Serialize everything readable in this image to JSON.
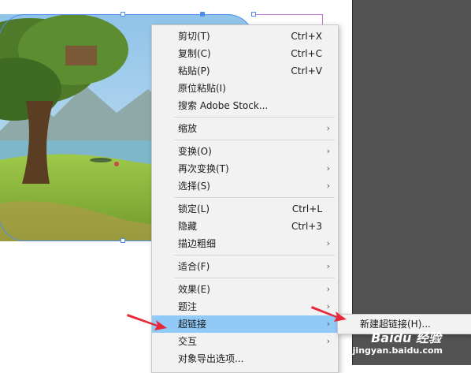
{
  "menu": {
    "items": [
      {
        "label": "剪切(T)",
        "shortcut": "Ctrl+X",
        "submenu": false
      },
      {
        "label": "复制(C)",
        "shortcut": "Ctrl+C",
        "submenu": false
      },
      {
        "label": "粘贴(P)",
        "shortcut": "Ctrl+V",
        "submenu": false
      },
      {
        "label": "原位粘贴(I)",
        "shortcut": "",
        "submenu": false
      },
      {
        "label": "搜索 Adobe Stock...",
        "shortcut": "",
        "submenu": false
      },
      {
        "label": "缩放",
        "shortcut": "",
        "submenu": true
      },
      {
        "label": "变换(O)",
        "shortcut": "",
        "submenu": true
      },
      {
        "label": "再次变换(T)",
        "shortcut": "",
        "submenu": true
      },
      {
        "label": "选择(S)",
        "shortcut": "",
        "submenu": true
      },
      {
        "label": "锁定(L)",
        "shortcut": "Ctrl+L",
        "submenu": false
      },
      {
        "label": "隐藏",
        "shortcut": "Ctrl+3",
        "submenu": false
      },
      {
        "label": "描边粗细",
        "shortcut": "",
        "submenu": true
      },
      {
        "label": "适合(F)",
        "shortcut": "",
        "submenu": true
      },
      {
        "label": "效果(E)",
        "shortcut": "",
        "submenu": true
      },
      {
        "label": "题注",
        "shortcut": "",
        "submenu": true
      },
      {
        "label": "超链接",
        "shortcut": "",
        "submenu": true,
        "highlighted": true
      },
      {
        "label": "交互",
        "shortcut": "",
        "submenu": true
      },
      {
        "label": "对象导出选项...",
        "shortcut": "",
        "submenu": false
      }
    ],
    "submenu_arrow": "›"
  },
  "submenu": {
    "items": [
      {
        "label": "新建超链接(H)..."
      }
    ]
  },
  "watermark": {
    "logo": "Baidu 经验",
    "url": "jingyan.baidu.com"
  },
  "colors": {
    "highlight": "#91c9f7",
    "selection": "#4d8ef0",
    "pointer_arrow": "#e8283a",
    "pasteboard": "#535353"
  }
}
